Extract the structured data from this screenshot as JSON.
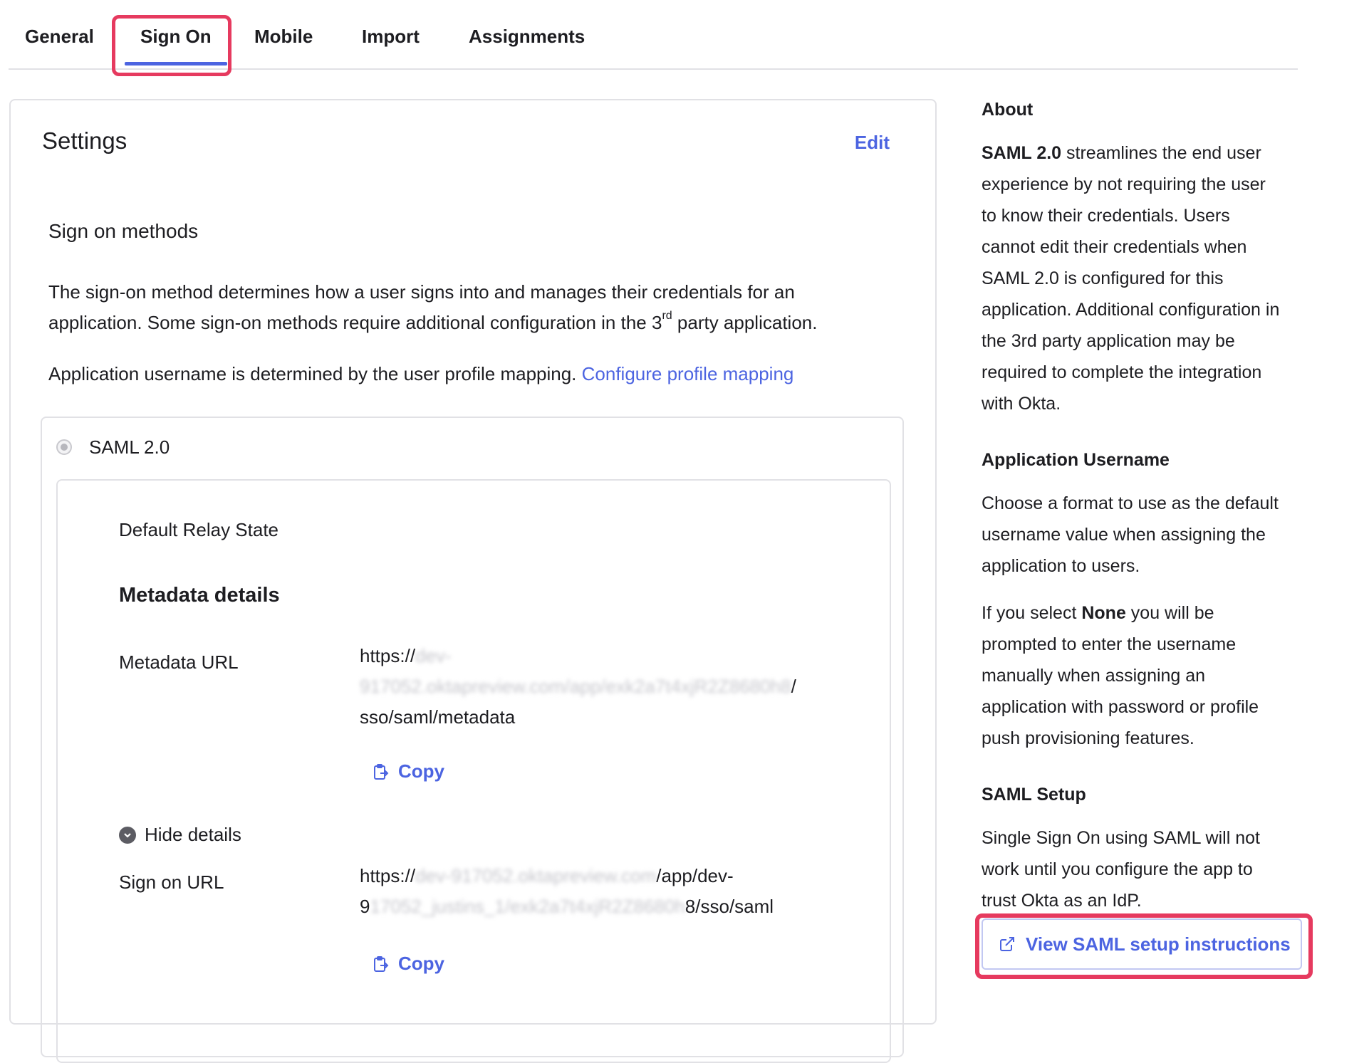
{
  "tabs": [
    "General",
    "Sign On",
    "Mobile",
    "Import",
    "Assignments"
  ],
  "settings": {
    "title": "Settings",
    "edit": "Edit",
    "sign_on_methods_title": "Sign on methods",
    "desc_line1": "The sign-on method determines how a user signs into and manages their credentials for an",
    "desc_line2_pre": "application. Some sign-on methods require additional configuration in the 3",
    "desc_sup": "rd",
    "desc_line2_post": " party application.",
    "username_text": "Application username is determined by the user profile mapping. ",
    "configure_link": "Configure profile mapping",
    "method_label": "SAML 2.0",
    "default_relay_state": "Default Relay State",
    "metadata_details": "Metadata details",
    "metadata_url_label": "Metadata URL",
    "metadata_url_prefix": "https://",
    "metadata_url_blur1": "dev-",
    "metadata_url_blur2": "917052.oktapreview.com/app/exk2a7t4xjR2Z8680h8",
    "metadata_url_mid": "/",
    "metadata_url_suffix": "sso/saml/metadata",
    "copy_label": "Copy",
    "hide_details": "Hide details",
    "sign_on_url_label": "Sign on URL",
    "sign_on_url_prefix": "https://",
    "sign_on_url_blur1": "dev-917052.oktapreview.com",
    "sign_on_url_mid": "/app/dev-",
    "sign_on_url_line2_pre": "9",
    "sign_on_url_blur2": "17052_justins_1/exk2a7t4xjR2Z8680h",
    "sign_on_url_suffix": "8/sso/saml"
  },
  "sidebar": {
    "about_title": "About",
    "about_bold": "SAML 2.0",
    "about_lines": [
      " streamlines the end user",
      "experience by not requiring the user",
      "to know their credentials. Users",
      "cannot edit their credentials when",
      "SAML 2.0 is configured for this",
      "application. Additional configuration in",
      "the 3rd party application may be",
      "required to complete the integration",
      "with Okta."
    ],
    "app_username_title": "Application Username",
    "app_username_lines": [
      "Choose a format to use as the default",
      "username value when assigning the",
      "application to users."
    ],
    "none_pre": "If you select ",
    "none_bold": "None",
    "none_lines": [
      " you will be",
      "prompted to enter the username",
      "manually when assigning an",
      "application with password or profile",
      "push provisioning features."
    ],
    "saml_setup_title": "SAML Setup",
    "saml_setup_lines": [
      "Single Sign On using SAML will not",
      "work until you configure the app to",
      "trust Okta as an IdP."
    ],
    "view_instructions": "View SAML setup instructions"
  },
  "colors": {
    "accent": "#4c64e1",
    "highlight": "#e63a5f",
    "border": "#e1e1e5"
  },
  "icons": {
    "copy": "clipboard-copy-icon",
    "hide": "chevron-circle-icon",
    "external": "external-link-icon"
  }
}
